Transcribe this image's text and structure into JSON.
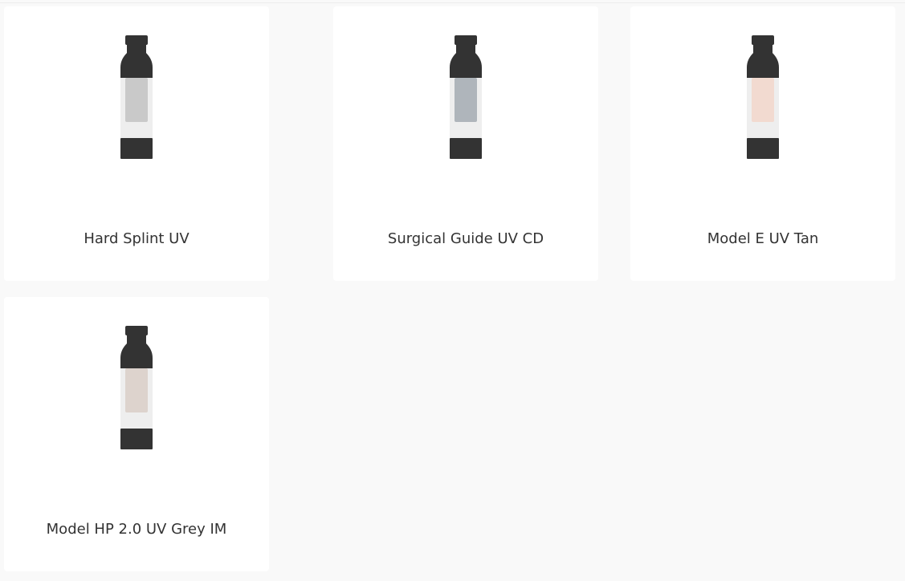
{
  "products": [
    {
      "name": "Hard Splint UV",
      "resin_color": "#c9c9c9",
      "icon": "resin-bottle-icon"
    },
    {
      "name": "Surgical Guide UV CD",
      "resin_color": "#afb5bb",
      "icon": "resin-bottle-icon"
    },
    {
      "name": "Model E UV Tan",
      "resin_color": "#f2dad0",
      "icon": "resin-bottle-icon"
    },
    {
      "name": "Model HP 2.0 UV Grey IM",
      "resin_color": "#ddd3cd",
      "icon": "resin-bottle-icon"
    }
  ],
  "colors": {
    "page_background": "#f9f9f9",
    "card_background": "#ffffff",
    "bottle_cap": "#333333",
    "bottle_body": "#eeeeee"
  }
}
